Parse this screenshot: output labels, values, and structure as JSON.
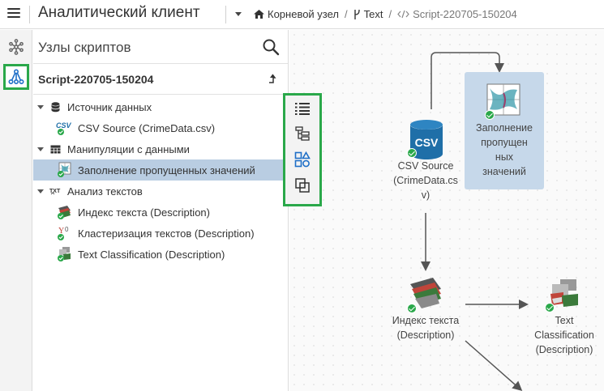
{
  "header": {
    "app_title": "Аналитический клиент",
    "breadcrumbs": [
      "Корневой узел",
      "Text",
      "Script-220705-150204"
    ]
  },
  "panel": {
    "title": "Узлы скриптов",
    "script_name": "Script-220705-150204",
    "categories": [
      {
        "label": "Источник данных",
        "items": [
          "CSV Source (CrimeData.csv)"
        ]
      },
      {
        "label": "Манипуляции с данными",
        "items": [
          "Заполнение пропущенных значений"
        ]
      },
      {
        "label": "Анализ текстов",
        "items": [
          "Индекс текста (Description)",
          "Кластеризация текстов (Description)",
          "Text Classification (Description)"
        ]
      }
    ],
    "selected_item": "Заполнение пропущенных значений"
  },
  "canvas": {
    "nodes": [
      {
        "label": "CSV Source (CrimeData.csv)",
        "display": [
          "CSV Source",
          "(CrimeData.cs",
          "v)"
        ],
        "icon": "csv-database-icon"
      },
      {
        "label": "Заполнение пропущенных значений",
        "display": [
          "Заполнение",
          "пропущен",
          "ных",
          "значений"
        ],
        "icon": "fill-missing-icon"
      },
      {
        "label": "Индекс текста (Description)",
        "display": [
          "Индекс текста",
          "(Description)"
        ],
        "icon": "text-index-icon"
      },
      {
        "label": "Text Classification (Description)",
        "display": [
          "Text",
          "Classification",
          "(Description)"
        ],
        "icon": "text-classification-icon"
      }
    ],
    "csv_icon_text": "CSV"
  },
  "colors": {
    "accent_green": "#2aa84a",
    "selection": "#b9cde2",
    "node_selected": "#c6d8ea",
    "db_blue": "#1f6fa8"
  }
}
